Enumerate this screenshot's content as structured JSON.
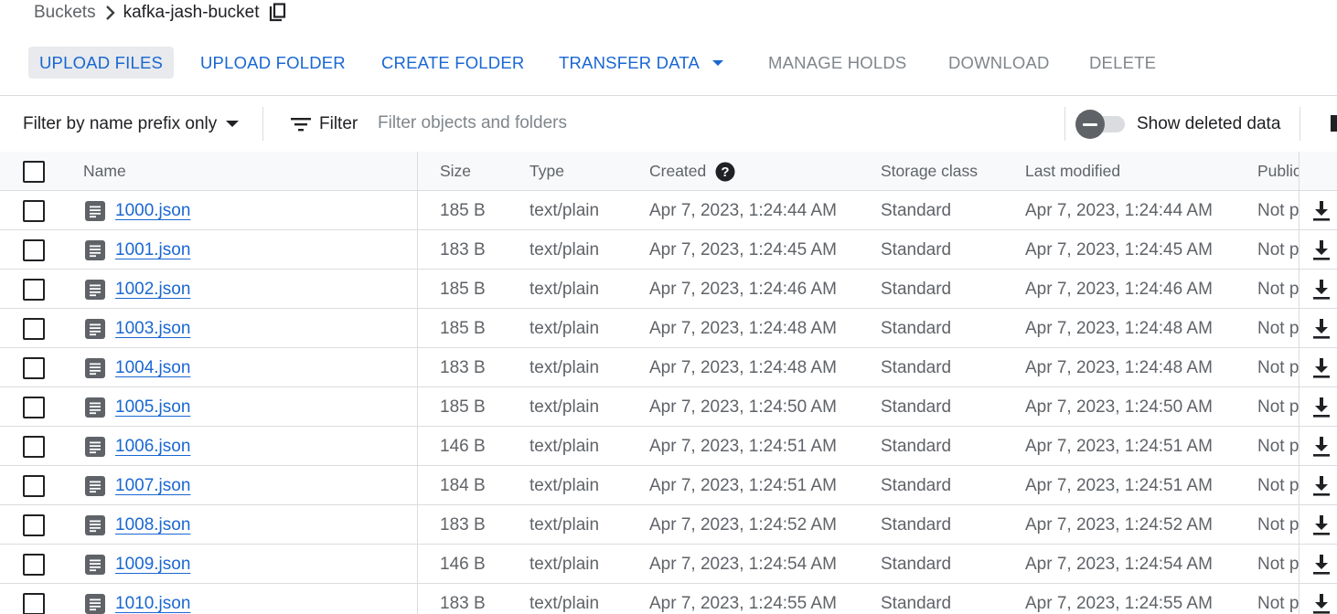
{
  "breadcrumb": {
    "parent": "Buckets",
    "current": "kafka-jash-bucket"
  },
  "toolbar": {
    "upload_files": "UPLOAD FILES",
    "upload_folder": "UPLOAD FOLDER",
    "create_folder": "CREATE FOLDER",
    "transfer_data": "TRANSFER DATA",
    "manage_holds": "MANAGE HOLDS",
    "download": "DOWNLOAD",
    "delete": "DELETE"
  },
  "filterbar": {
    "prefix_label": "Filter by name prefix only",
    "filter_label": "Filter",
    "search_placeholder": "Filter objects and folders",
    "show_deleted_label": "Show deleted data"
  },
  "table": {
    "headers": {
      "name": "Name",
      "size": "Size",
      "type": "Type",
      "created": "Created",
      "storage_class": "Storage class",
      "last_modified": "Last modified",
      "public": "Public access"
    },
    "rows": [
      {
        "name": "1000.json",
        "size": "185 B",
        "type": "text/plain",
        "created": "Apr 7, 2023, 1:24:44 AM",
        "storage": "Standard",
        "modified": "Apr 7, 2023, 1:24:44 AM",
        "public": "Not public"
      },
      {
        "name": "1001.json",
        "size": "183 B",
        "type": "text/plain",
        "created": "Apr 7, 2023, 1:24:45 AM",
        "storage": "Standard",
        "modified": "Apr 7, 2023, 1:24:45 AM",
        "public": "Not public"
      },
      {
        "name": "1002.json",
        "size": "185 B",
        "type": "text/plain",
        "created": "Apr 7, 2023, 1:24:46 AM",
        "storage": "Standard",
        "modified": "Apr 7, 2023, 1:24:46 AM",
        "public": "Not public"
      },
      {
        "name": "1003.json",
        "size": "185 B",
        "type": "text/plain",
        "created": "Apr 7, 2023, 1:24:48 AM",
        "storage": "Standard",
        "modified": "Apr 7, 2023, 1:24:48 AM",
        "public": "Not public"
      },
      {
        "name": "1004.json",
        "size": "183 B",
        "type": "text/plain",
        "created": "Apr 7, 2023, 1:24:48 AM",
        "storage": "Standard",
        "modified": "Apr 7, 2023, 1:24:48 AM",
        "public": "Not public"
      },
      {
        "name": "1005.json",
        "size": "185 B",
        "type": "text/plain",
        "created": "Apr 7, 2023, 1:24:50 AM",
        "storage": "Standard",
        "modified": "Apr 7, 2023, 1:24:50 AM",
        "public": "Not public"
      },
      {
        "name": "1006.json",
        "size": "146 B",
        "type": "text/plain",
        "created": "Apr 7, 2023, 1:24:51 AM",
        "storage": "Standard",
        "modified": "Apr 7, 2023, 1:24:51 AM",
        "public": "Not public"
      },
      {
        "name": "1007.json",
        "size": "184 B",
        "type": "text/plain",
        "created": "Apr 7, 2023, 1:24:51 AM",
        "storage": "Standard",
        "modified": "Apr 7, 2023, 1:24:51 AM",
        "public": "Not public"
      },
      {
        "name": "1008.json",
        "size": "183 B",
        "type": "text/plain",
        "created": "Apr 7, 2023, 1:24:52 AM",
        "storage": "Standard",
        "modified": "Apr 7, 2023, 1:24:52 AM",
        "public": "Not public"
      },
      {
        "name": "1009.json",
        "size": "146 B",
        "type": "text/plain",
        "created": "Apr 7, 2023, 1:24:54 AM",
        "storage": "Standard",
        "modified": "Apr 7, 2023, 1:24:54 AM",
        "public": "Not public"
      },
      {
        "name": "1010.json",
        "size": "183 B",
        "type": "text/plain",
        "created": "Apr 7, 2023, 1:24:55 AM",
        "storage": "Standard",
        "modified": "Apr 7, 2023, 1:24:55 AM",
        "public": "Not public"
      }
    ]
  },
  "colors": {
    "primary": "#1967d2",
    "disabled": "#80868b",
    "header_bg": "#f8f9fa",
    "divider": "#dadce0"
  }
}
